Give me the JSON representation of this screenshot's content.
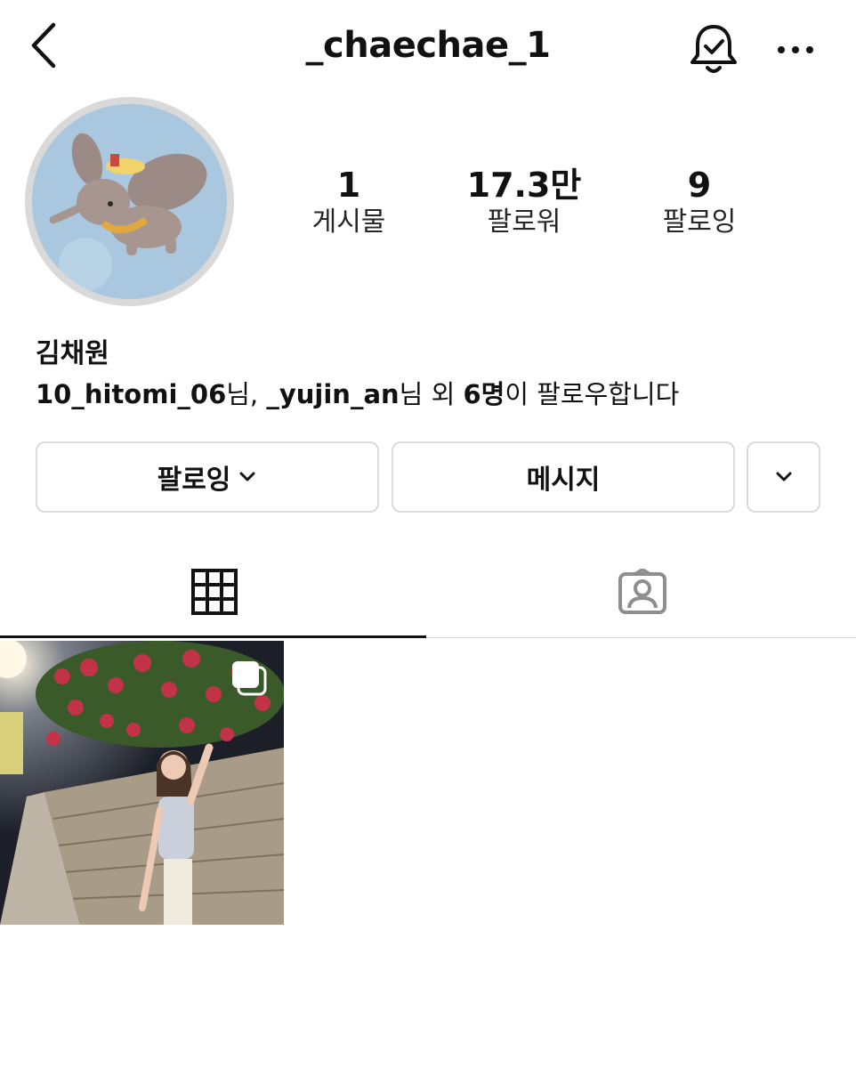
{
  "header": {
    "title": "_chaechae_1"
  },
  "stats": [
    {
      "value": "1",
      "label": "게시물"
    },
    {
      "value": "17.3만",
      "label": "팔로워"
    },
    {
      "value": "9",
      "label": "팔로잉"
    }
  ],
  "profile": {
    "name": "김채원",
    "followed_by": {
      "user1": "10_hitomi_06",
      "suffix1": "님, ",
      "user2": "_yujin_an",
      "suffix2": "님 외 ",
      "count": "6명",
      "suffix3": "이 팔로우합니다"
    }
  },
  "buttons": {
    "following": "팔로잉",
    "message": "메시지"
  },
  "icons": {
    "back": "chevron-left-icon",
    "notifications": "bell-check-icon",
    "more": "more-horizontal-icon",
    "grid_tab": "grid-icon",
    "tagged_tab": "tagged-person-icon",
    "post_multi": "carousel-icon"
  },
  "colors": {
    "background": "#ffffff",
    "border": "#dbdbdb",
    "text": "#111111",
    "avatar_bg": "#a9c8e0"
  }
}
